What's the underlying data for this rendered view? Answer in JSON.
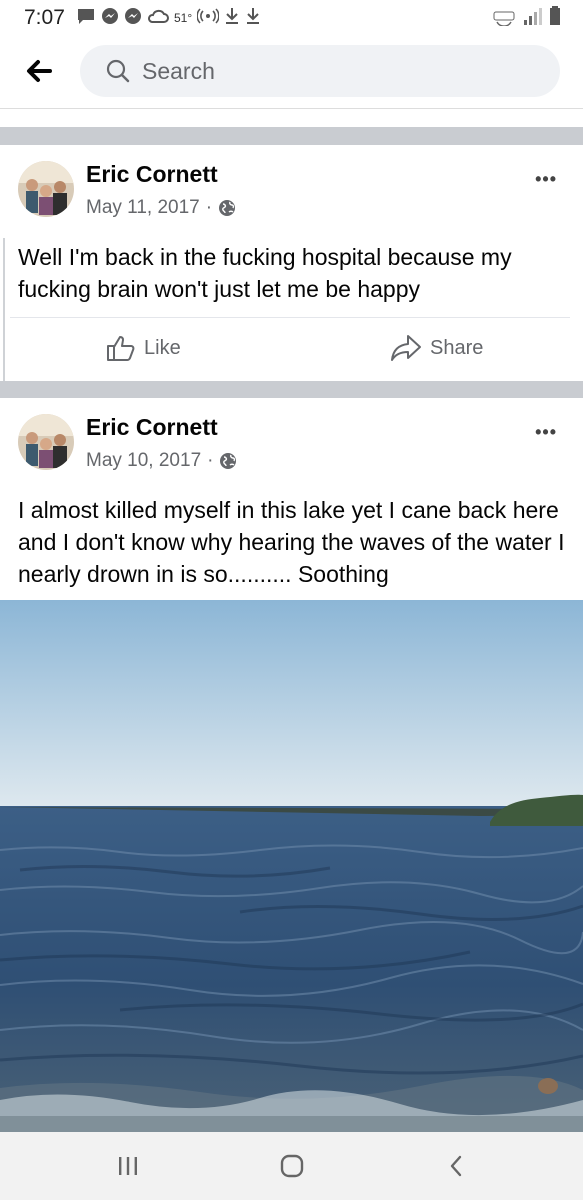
{
  "status_bar": {
    "time": "7:07",
    "temperature": "51°",
    "icons": [
      "message-icon",
      "messenger-icon",
      "messenger-icon",
      "cloud-icon",
      "hotspot-icon",
      "download-icon",
      "download-icon",
      "volte-icon",
      "lte-signal-icon",
      "battery-icon"
    ]
  },
  "search": {
    "placeholder": "Search"
  },
  "posts": [
    {
      "author": "Eric Cornett",
      "date": "May 11, 2017",
      "text": "Well I'm back in the fucking hospital because my fucking brain won't just let me be happy",
      "like_label": "Like",
      "share_label": "Share"
    },
    {
      "author": "Eric Cornett",
      "date": "May 10, 2017",
      "text": "I almost killed myself in this lake yet I cane back here and I don't know why hearing the waves of the water I nearly drown in is so.......... Soothing"
    }
  ],
  "colors": {
    "accent": "#1877f2",
    "secondary_text": "#65676b",
    "separator": "#c9ccd1"
  }
}
